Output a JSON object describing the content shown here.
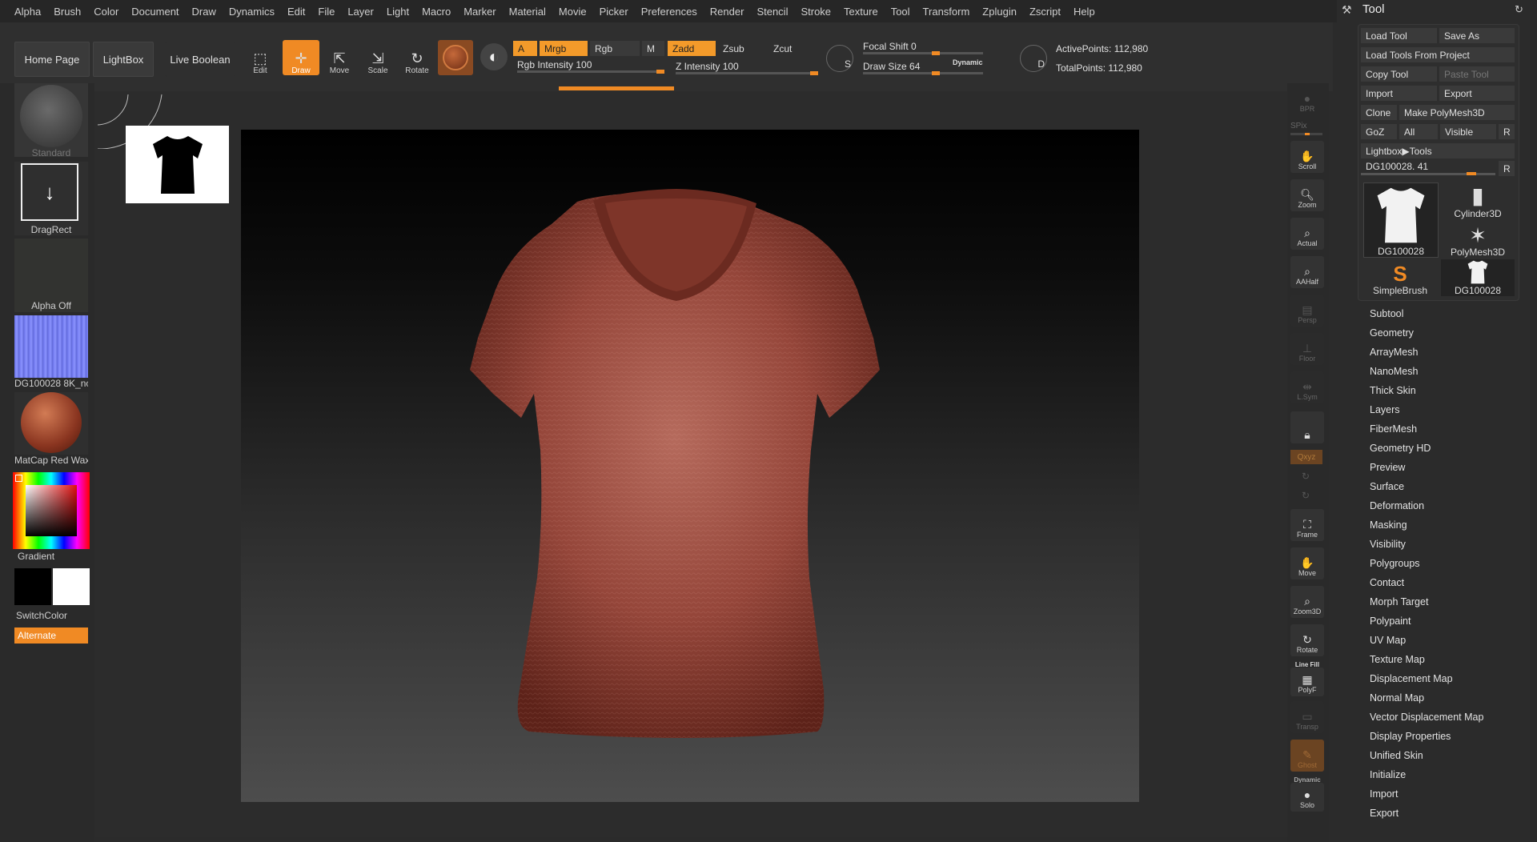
{
  "menu": [
    "Alpha",
    "Brush",
    "Color",
    "Document",
    "Draw",
    "Dynamics",
    "Edit",
    "File",
    "Layer",
    "Light",
    "Macro",
    "Marker",
    "Material",
    "Movie",
    "Picker",
    "Preferences",
    "Render",
    "Stencil",
    "Stroke",
    "Texture",
    "Tool",
    "Transform",
    "Zplugin",
    "Zscript",
    "Help"
  ],
  "top": {
    "home_page": "Home Page",
    "lightbox": "LightBox",
    "live_boolean": "Live Boolean",
    "edit": "Edit",
    "draw": "Draw",
    "move": "Move",
    "scale": "Scale",
    "rotate": "Rotate",
    "mode_a": "A",
    "mrgb": "Mrgb",
    "rgb": "Rgb",
    "m": "M",
    "zadd": "Zadd",
    "zsub": "Zsub",
    "zcut": "Zcut",
    "rgb_intensity": "Rgb Intensity 100",
    "z_intensity": "Z Intensity 100",
    "focal_shift": "Focal Shift 0",
    "draw_size": "Draw Size 64",
    "dynamic": "Dynamic",
    "active_points": "ActivePoints: 112,980",
    "total_points": "TotalPoints: 112,980",
    "s_label": "S",
    "d_label": "D"
  },
  "left": {
    "brush": "Standard",
    "stroke": "DragRect",
    "alpha": "Alpha Off",
    "texture": "DG100028 8K_nc",
    "material": "MatCap Red Wax",
    "gradient": "Gradient",
    "switch_color": "SwitchColor",
    "alternate": "Alternate",
    "colors": {
      "accent": "#f08a24",
      "main_color": "#000000",
      "secondary_color": "#ffffff"
    }
  },
  "right_strip": {
    "bpr": "BPR",
    "spix": "SPix",
    "scroll": "Scroll",
    "zoom": "Zoom",
    "actual": "Actual",
    "aahalf": "AAHalf",
    "persp": "Persp",
    "floor": "Floor",
    "lsym": "L.Sym",
    "xyz": "Qxyz",
    "frame": "Frame",
    "move": "Move",
    "zoom3d": "Zoom3D",
    "rotate": "Rotate",
    "line_fill": "Line Fill",
    "polyf": "PolyF",
    "transp": "Transp",
    "ghost": "Ghost",
    "dynamic": "Dynamic",
    "solo": "Solo"
  },
  "tool": {
    "title": "Tool",
    "load_tool": "Load Tool",
    "save_as": "Save As",
    "load_from_project": "Load Tools From Project",
    "copy_tool": "Copy Tool",
    "paste_tool": "Paste Tool",
    "import": "Import",
    "export": "Export",
    "clone": "Clone",
    "make_polymesh": "Make PolyMesh3D",
    "goz": "GoZ",
    "all": "All",
    "visible": "Visible",
    "r": "R",
    "lightbox_tools": "Lightbox▶Tools",
    "current": "DG100028. 41",
    "tiles": [
      "DG100028",
      "Cylinder3D",
      "PolyMesh3D",
      "SimpleBrush",
      "DG100028"
    ],
    "sections": [
      "Subtool",
      "Geometry",
      "ArrayMesh",
      "NanoMesh",
      "Thick Skin",
      "Layers",
      "FiberMesh",
      "Geometry HD",
      "Preview",
      "Surface",
      "Deformation",
      "Masking",
      "Visibility",
      "Polygroups",
      "Contact",
      "Morph Target",
      "Polypaint",
      "UV Map",
      "Texture Map",
      "Displacement Map",
      "Normal Map",
      "Vector Displacement Map",
      "Display Properties",
      "Unified Skin",
      "Initialize",
      "Import",
      "Export"
    ]
  }
}
